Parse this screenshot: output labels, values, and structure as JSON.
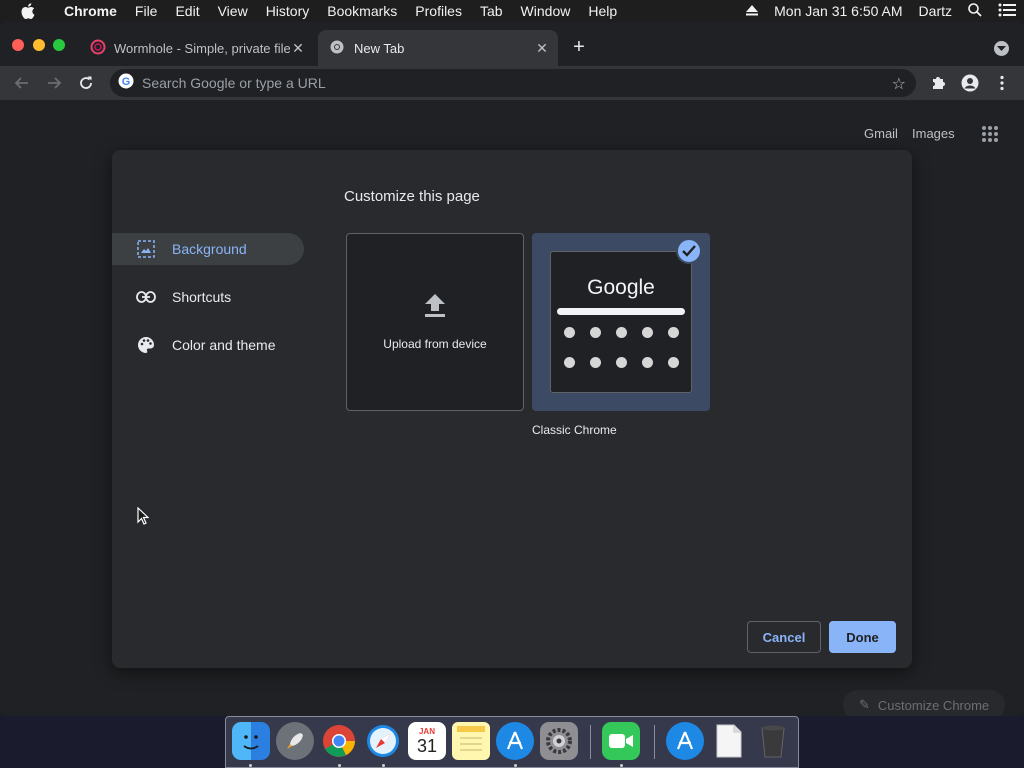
{
  "menubar": {
    "items": [
      "Chrome",
      "File",
      "Edit",
      "View",
      "History",
      "Bookmarks",
      "Profiles",
      "Tab",
      "Window",
      "Help"
    ],
    "datetime": "Mon Jan 31  6:50 AM",
    "user": "Dartz"
  },
  "tabs": [
    {
      "title": "Wormhole - Simple, private file",
      "active": false
    },
    {
      "title": "New Tab",
      "active": true
    }
  ],
  "omnibox": {
    "placeholder": "Search Google or type a URL"
  },
  "ntp": {
    "gmail": "Gmail",
    "images": "Images",
    "customize_chrome": "Customize Chrome"
  },
  "dialog": {
    "title": "Customize this page",
    "nav": [
      {
        "label": "Background",
        "icon": "image-icon",
        "active": true
      },
      {
        "label": "Shortcuts",
        "icon": "link-icon",
        "active": false
      },
      {
        "label": "Color and theme",
        "icon": "palette-icon",
        "active": false
      }
    ],
    "upload_label": "Upload from device",
    "classic_label": "Classic Chrome",
    "classic_preview_logo": "Google",
    "cancel": "Cancel",
    "done": "Done"
  },
  "dock": {
    "calendar_month": "JAN",
    "calendar_day": "31"
  },
  "colors": {
    "accent": "#8ab4f8",
    "page_bg": "#202124",
    "dialog_bg": "#292a2d"
  }
}
